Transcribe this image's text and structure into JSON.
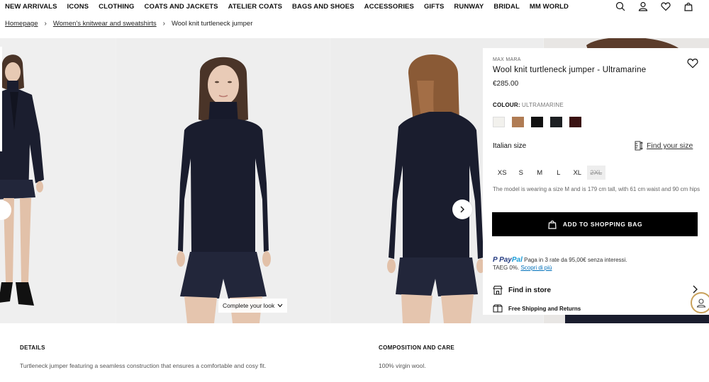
{
  "nav": {
    "items": [
      "NEW ARRIVALS",
      "ICONS",
      "CLOTHING",
      "COATS AND JACKETS",
      "ATELIER COATS",
      "BAGS AND SHOES",
      "ACCESSORIES",
      "GIFTS",
      "RUNWAY",
      "BRIDAL",
      "MM WORLD"
    ],
    "icons": [
      "search-icon",
      "account-icon",
      "wishlist-icon",
      "bag-icon"
    ]
  },
  "breadcrumb": {
    "home": "Homepage",
    "category": "Women's knitwear and sweatshirts",
    "current": "Wool knit turtleneck jumper"
  },
  "gallery": {
    "complete_look": "Complete your look",
    "colors": {
      "sweater": "#1a1d2e",
      "shorts": "#22263a",
      "background": "#eeeeee"
    }
  },
  "product": {
    "brand": "MAX MARA",
    "title": "Wool knit turtleneck jumper - Ultramarine",
    "price": "€285.00",
    "colour_label": "COLOUR:",
    "colour_value": "ULTRAMARINE",
    "swatches": [
      "#f2f1ed",
      "#b07c54",
      "#111111",
      "#1c1f22",
      "#3a1212"
    ],
    "size_label": "Italian size",
    "find_size": "Find your size",
    "sizes": [
      "XS",
      "S",
      "M",
      "L",
      "XL",
      "2XL"
    ],
    "model_note": "The model is wearing a size M and is 179 cm tall, with 61 cm waist and 90 cm hips",
    "add_to_bag": "ADD TO SHOPPING BAG",
    "paypal_line1": "Paga in 3 rate da 95,00€ senza interessi.",
    "paypal_line2": "TAEG 0%.",
    "paypal_link": "Scopri di più",
    "find_in_store": "Find in store",
    "shipping": "Free Shipping and Returns"
  },
  "details": {
    "heading": "DETAILS",
    "text": "Turtleneck jumper featuring a seamless construction that ensures a comfortable and cosy fit."
  },
  "composition": {
    "heading": "COMPOSITION AND CARE",
    "text": "100% virgin wool."
  }
}
